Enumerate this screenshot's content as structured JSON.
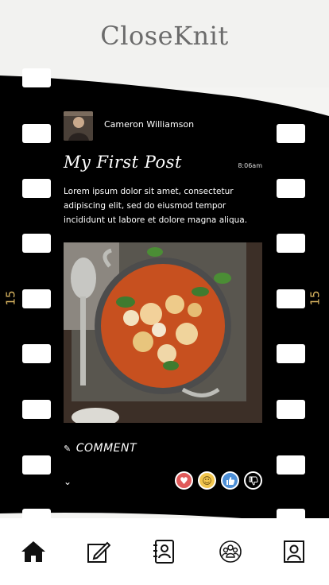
{
  "app": {
    "title": "CloseKnit"
  },
  "film": {
    "frame_number": "15"
  },
  "post": {
    "author": "Cameron Williamson",
    "title": "My First Post",
    "time": "8:06am",
    "body": "Lorem ipsum dolor sit amet, consectetur adipiscing elit, sed do eiusmod tempor incididunt ut labore et dolore magna aliqua.",
    "image_alt": "Baked gnocchi with tomato and basil",
    "comment_label": "COMMENT"
  },
  "reactions": [
    {
      "name": "heart-reaction",
      "icon": "heart",
      "color": "#e05a5a"
    },
    {
      "name": "smile-reaction",
      "icon": "smile",
      "color": "#f2c64d"
    },
    {
      "name": "thumbs-up-reaction",
      "icon": "thumbs-up",
      "color": "#4d8fd6"
    },
    {
      "name": "thumbs-down-reaction",
      "icon": "thumbs-down",
      "color": "#000000"
    }
  ],
  "nav": {
    "items": [
      {
        "name": "home",
        "icon": "home-icon"
      },
      {
        "name": "write",
        "icon": "edit-icon"
      },
      {
        "name": "contacts",
        "icon": "address-book-icon"
      },
      {
        "name": "groups",
        "icon": "group-icon"
      },
      {
        "name": "profile",
        "icon": "profile-icon"
      }
    ]
  },
  "colors": {
    "film": "#000000",
    "accent_number": "#d9b560",
    "title": "#6b6b6b"
  }
}
